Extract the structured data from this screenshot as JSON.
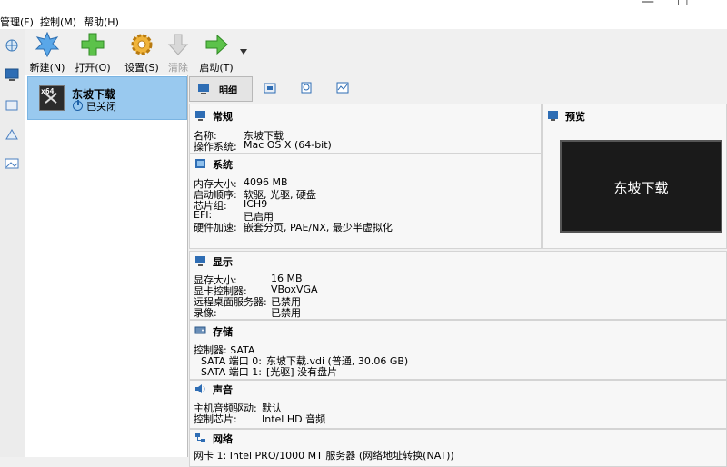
{
  "menu": {
    "manage": "管理(F)",
    "control": "控制(M)",
    "help": "帮助(H)"
  },
  "window": {
    "minimize": "—",
    "maximize": "☐"
  },
  "toolbar": {
    "new": "新建(N)",
    "open": "打开(O)",
    "settings": "设置(S)",
    "discard": "清除",
    "start": "启动(T)"
  },
  "vm": {
    "name": "东坡下载",
    "state": "已关闭",
    "os_badge": "x64"
  },
  "tabs": {
    "details": "明细"
  },
  "general": {
    "title": "常规",
    "name_label": "名称:",
    "name_value": "东坡下载",
    "os_label": "操作系统:",
    "os_value": "Mac OS X (64-bit)"
  },
  "system": {
    "title": "系统",
    "memory_label": "内存大小:",
    "memory_value": "4096 MB",
    "boot_label": "启动顺序:",
    "boot_value": "软驱, 光驱, 硬盘",
    "chipset_label": "芯片组:",
    "chipset_value": "ICH9",
    "efi_label": "EFI:",
    "efi_value": "已启用",
    "accel_label": "硬件加速:",
    "accel_value": "嵌套分页, PAE/NX, 最少半虚拟化"
  },
  "preview": {
    "title": "预览",
    "screen_text": "东坡下载"
  },
  "display": {
    "title": "显示",
    "vram_label": "显存大小:",
    "vram_value": "16 MB",
    "controller_label": "显卡控制器:",
    "controller_value": "VBoxVGA",
    "rdp_label": "远程桌面服务器:",
    "rdp_value": "已禁用",
    "recording_label": "录像:",
    "recording_value": "已禁用"
  },
  "storage": {
    "title": "存储",
    "controller": "控制器: SATA",
    "port0_label": "SATA 端口 0:",
    "port0_value": "东坡下载.vdi (普通, 30.06 GB)",
    "port1_label": "SATA 端口 1:",
    "port1_value": "[光驱] 没有盘片"
  },
  "audio": {
    "title": "声音",
    "driver_label": "主机音频驱动:",
    "driver_value": "默认",
    "chip_label": "控制芯片:",
    "chip_value": "Intel HD 音频"
  },
  "network": {
    "title": "网络",
    "adapter1": "网卡 1:  Intel PRO/1000 MT 服务器 (网络地址转换(NAT))"
  }
}
